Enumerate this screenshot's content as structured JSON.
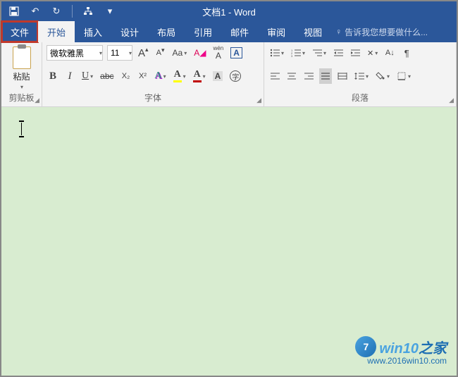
{
  "title": "文档1 - Word",
  "tellme": "告诉我您想要做什么...",
  "tabs": {
    "file": "文件",
    "home": "开始",
    "insert": "插入",
    "design": "设计",
    "layout": "布局",
    "references": "引用",
    "mail": "邮件",
    "review": "审阅",
    "view": "视图"
  },
  "groups": {
    "clipboard": "剪贴板",
    "font": "字体",
    "paragraph": "段落"
  },
  "clipboard": {
    "paste": "粘贴"
  },
  "font": {
    "name": "微软雅黑",
    "size": "11",
    "growA": "A",
    "shrinkA": "A",
    "caseAa": "Aa",
    "ruby": "wén",
    "rubyA": "A",
    "boxA": "A",
    "bold": "B",
    "italic": "I",
    "underline": "U",
    "strike": "abc",
    "sub": "X₂",
    "sup": "X²",
    "textfxA": "A",
    "highlightA": "A",
    "colorA": "A",
    "charshadeA": "A",
    "enclosedA": "字"
  },
  "watermark": {
    "circle": "7",
    "brand_pre": "win10",
    "brand_post": "之家",
    "url": "www.2016win10.com"
  }
}
